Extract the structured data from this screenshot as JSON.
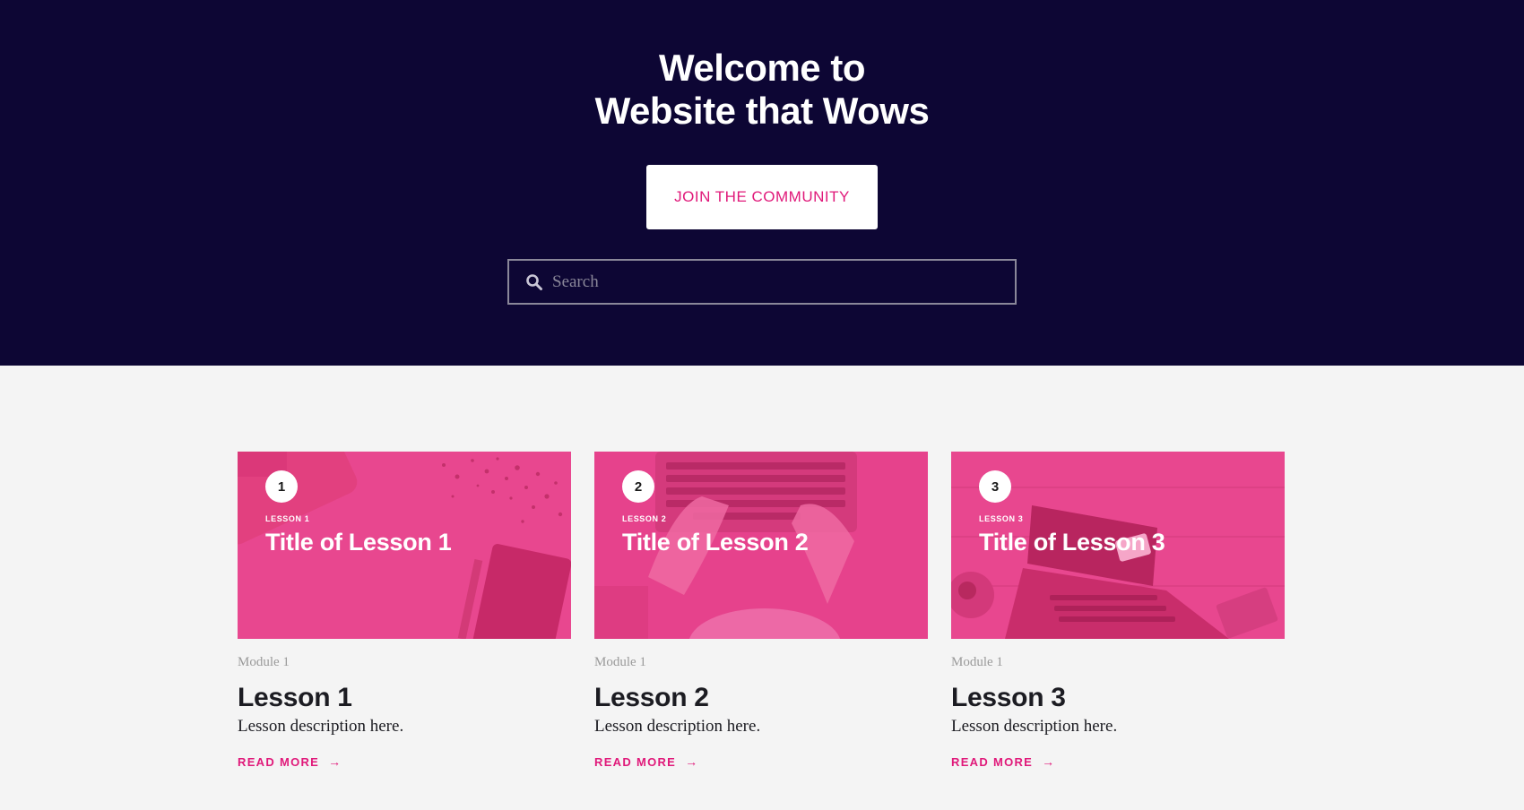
{
  "hero": {
    "title_line1": "Welcome to",
    "title_line2": "Website that Wows",
    "cta_label": "JOIN THE COMMUNITY",
    "search_placeholder": "Search",
    "search_icon": "magnifier-icon"
  },
  "colors": {
    "hero_bg": "#0d0634",
    "accent": "#e0197a",
    "card_overlay": "#e8478f",
    "page_bg": "#f4f4f4"
  },
  "lessons": [
    {
      "number": "1",
      "kicker": "LESSON 1",
      "thumb_title": "Title of Lesson 1",
      "thumb_art": "notebook-and-confetti-illustration",
      "module": "Module 1",
      "title": "Lesson 1",
      "description": "Lesson description here.",
      "link_label": "READ MORE",
      "link_icon": "arrow-right-icon"
    },
    {
      "number": "2",
      "kicker": "LESSON 2",
      "thumb_title": "Title of Lesson 2",
      "thumb_art": "hands-on-keyboard-illustration",
      "module": "Module 1",
      "title": "Lesson 2",
      "description": "Lesson description here.",
      "link_label": "READ MORE",
      "link_icon": "arrow-right-icon"
    },
    {
      "number": "3",
      "kicker": "LESSON 3",
      "thumb_title": "Title of Lesson 3",
      "thumb_art": "laptop-and-credit-card-illustration",
      "module": "Module 1",
      "title": "Lesson 3",
      "description": "Lesson description here.",
      "link_label": "READ MORE",
      "link_icon": "arrow-right-icon"
    }
  ]
}
